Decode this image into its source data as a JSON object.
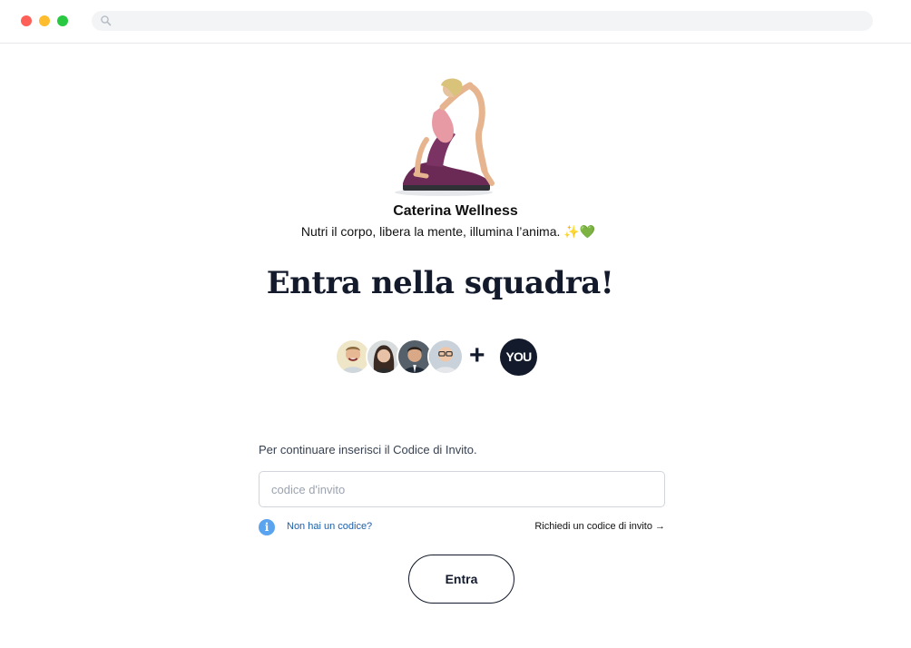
{
  "browser": {
    "traffic_lights": [
      "#fe5f57",
      "#febc2e",
      "#28c840"
    ],
    "search_icon": "search-icon",
    "url": ""
  },
  "profile": {
    "name": "Caterina Wellness",
    "bio_text": "Nutri il corpo, libera la mente, illumina l’anima. ",
    "bio_emoji_sparkle": "✨",
    "bio_emoji_heart": "💚"
  },
  "headline": "Entra nella squadra!",
  "team": {
    "avatars": [
      "avatar-1",
      "avatar-2",
      "avatar-3",
      "avatar-4"
    ],
    "plus": "+",
    "you_label": "YOU"
  },
  "form": {
    "prompt": "Per continuare inserisci il Codice di Invito.",
    "input_placeholder": "codice d'invito",
    "input_value": "",
    "info_icon": "info-icon",
    "no_code_link": "Non hai un codice?",
    "request_link": "Richiedi un codice di invito →",
    "submit_label": "Entra"
  },
  "colors": {
    "primary_dark": "#131a2b",
    "link_blue": "#1d5fa8",
    "info_blue": "#5aa4ef"
  }
}
